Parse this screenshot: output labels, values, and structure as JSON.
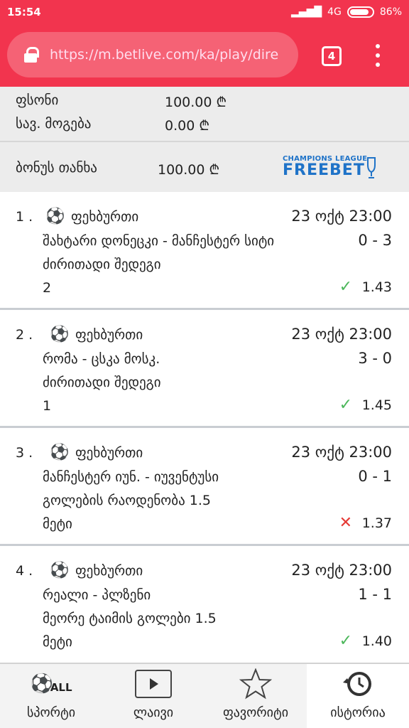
{
  "status_bar": {
    "time": "15:54",
    "network": "4G",
    "battery": "86%"
  },
  "browser": {
    "url": "https://m.betlive.com/ka/play/dire",
    "tab_count": "4"
  },
  "summary": {
    "price_label": "ფსონი",
    "price_value": "100.00 ₾",
    "win_label": "სავ. მოგება",
    "win_value": "0.00 ₾",
    "bonus_label": "ბონუს თანხა",
    "bonus_value": "100.00 ₾",
    "freebet_small": "CHAMPIONS LEAGUE",
    "freebet_big": "FREEBET"
  },
  "bets": [
    {
      "num": "1 .",
      "sport": "ფეხბურთი",
      "date": "23 ოქტ 23:00",
      "teams": "შახტარი დონეცკი - მანჩესტერ სიტი",
      "score": "0 - 3",
      "market": "ძირითადი შედეგი",
      "pick": "2",
      "status": "✓",
      "result": "win",
      "odd": "1.43"
    },
    {
      "num": "2 .",
      "sport": "ფეხბურთი",
      "date": "23 ოქტ 23:00",
      "teams": "რომა - ცსკა მოსკ.",
      "score": "3 - 0",
      "market": "ძირითადი შედეგი",
      "pick": "1",
      "status": "✓",
      "result": "win",
      "odd": "1.45"
    },
    {
      "num": "3 .",
      "sport": "ფეხბურთი",
      "date": "23 ოქტ 23:00",
      "teams": "მანჩესტერ იუნ. - იუვენტუსი",
      "score": "0 - 1",
      "market": "გოლების რაოდენობა 1.5",
      "pick": "მეტი",
      "status": "✕",
      "result": "lose",
      "odd": "1.37"
    },
    {
      "num": "4 .",
      "sport": "ფეხბურთი",
      "date": "23 ოქტ 23:00",
      "teams": "რეალი - პლზენი",
      "score": "1 - 1",
      "market": "მეორე ტაიმის გოლები 1.5",
      "pick": "მეტი",
      "status": "✓",
      "result": "win",
      "odd": "1.40"
    }
  ],
  "nav": {
    "all_badge": "ALL",
    "items": [
      {
        "label": "სპორტი",
        "icon": "sports-icon"
      },
      {
        "label": "ლაივი",
        "icon": "play-icon"
      },
      {
        "label": "ფავორიტი",
        "icon": "star-icon"
      },
      {
        "label": "ისტორია",
        "icon": "history-icon"
      }
    ]
  },
  "colors": {
    "brand": "#f2344e",
    "win": "#4cb75b",
    "lose": "#e53935",
    "freebet": "#1f73c8"
  }
}
